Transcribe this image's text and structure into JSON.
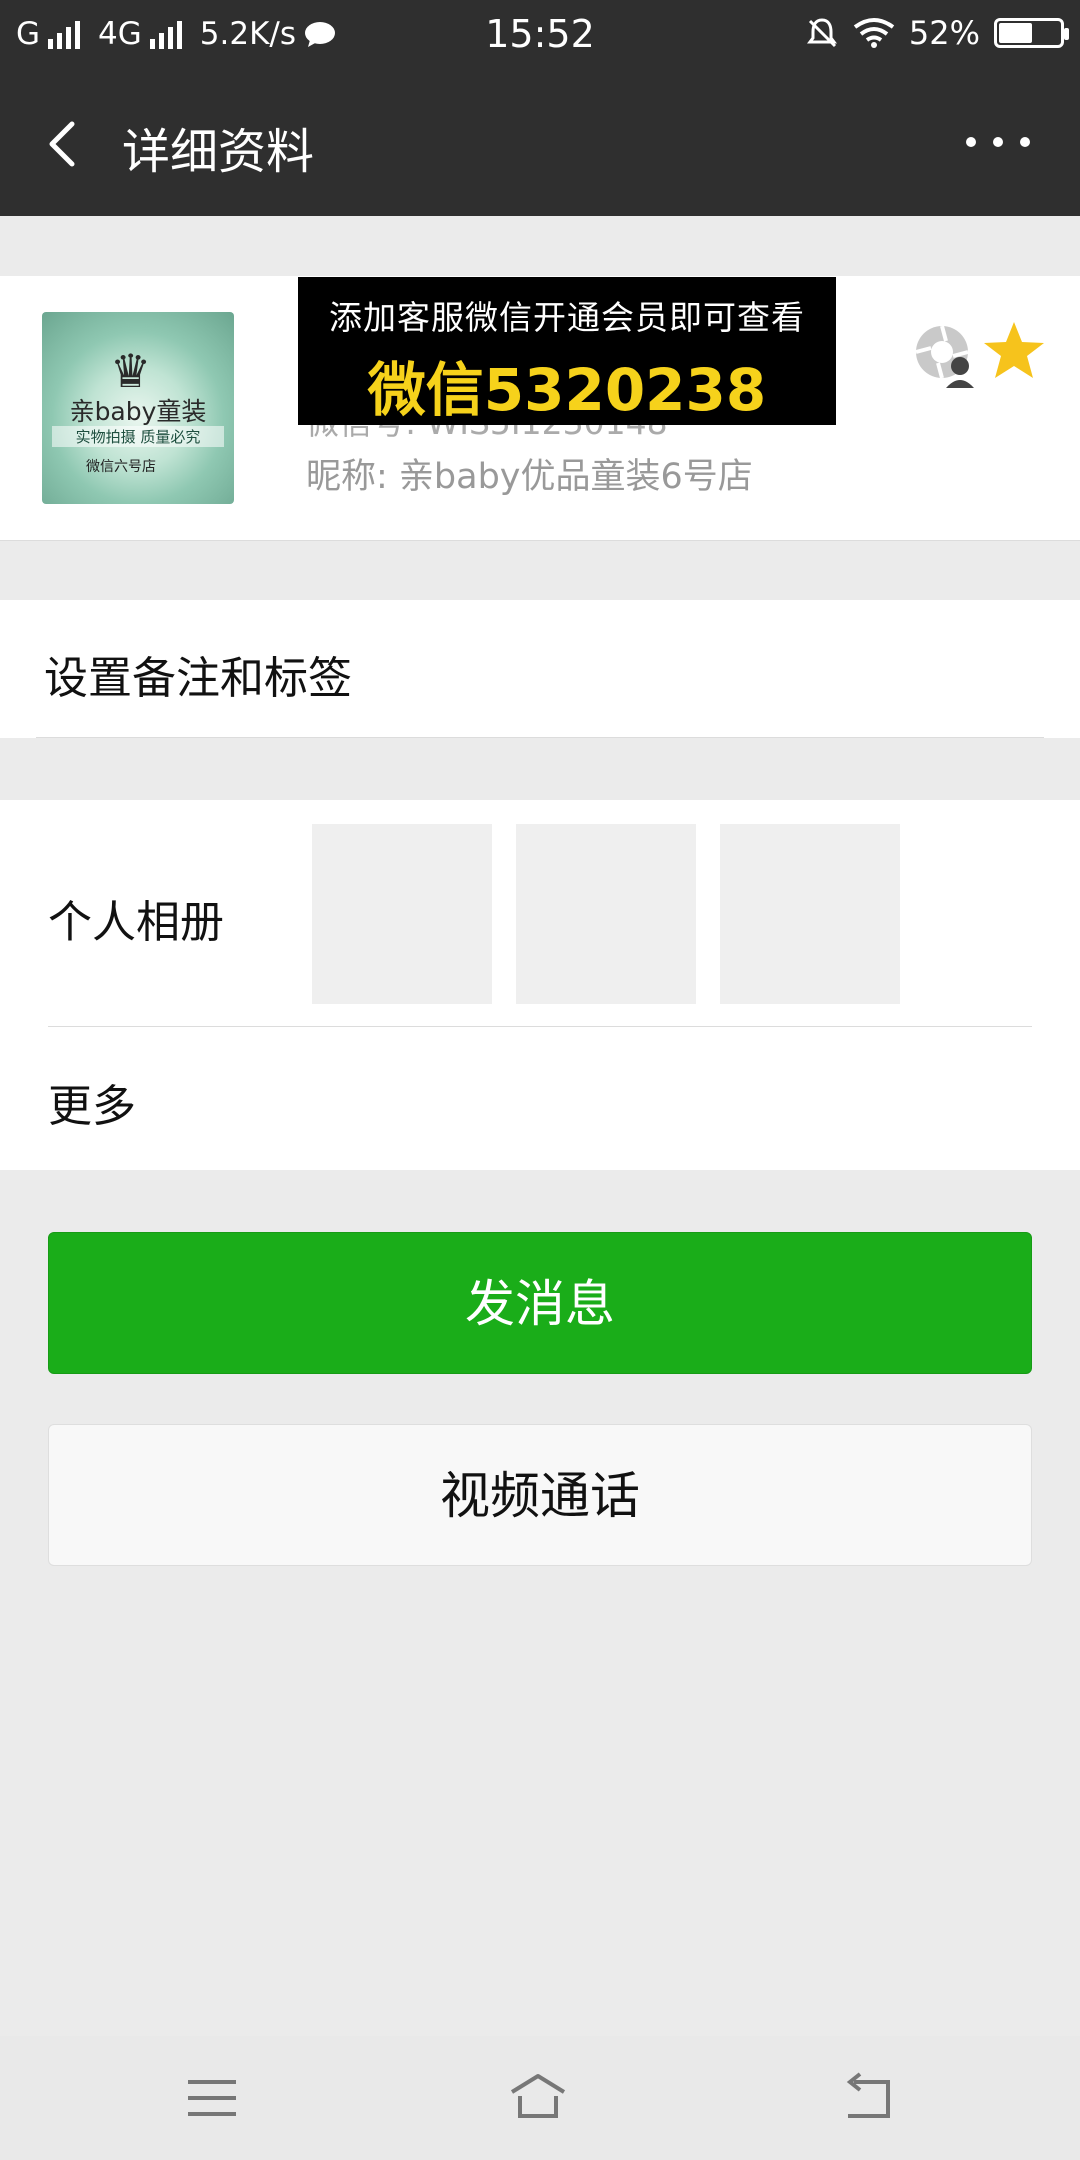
{
  "status_bar": {
    "carrier1": "G",
    "carrier2": "4G",
    "speed": "5.2K/s",
    "time": "15:52",
    "battery": "52%",
    "battery_level": 0.52
  },
  "header": {
    "title": "详细资料"
  },
  "profile": {
    "avatar_name": "亲baby童装",
    "avatar_tagline": "实物拍摄 质量必究",
    "avatar_store": "微信六号店",
    "wechat_id": "微信号: WIS5I1230148",
    "nickname": "昵称: 亲baby优品童装6号店",
    "banner_line1": "添加客服微信开通会员即可查看",
    "banner_line2": "微信5320238"
  },
  "rows": {
    "remark": "设置备注和标签",
    "album": "个人相册",
    "more": "更多"
  },
  "actions": {
    "send_message": "发消息",
    "video_call": "视频通话"
  },
  "colors": {
    "primary_green": "#1aad19",
    "title_bg": "#2f2f2f",
    "star": "#f6c31c",
    "banner_text": "#f6d21b"
  },
  "icons": {
    "back": "chevron-left-icon",
    "more": "more-dots-icon",
    "moments": "moments-shutter-icon",
    "star": "star-icon",
    "nav_menu": "menu-icon",
    "nav_home": "home-icon",
    "nav_back": "back-icon"
  }
}
